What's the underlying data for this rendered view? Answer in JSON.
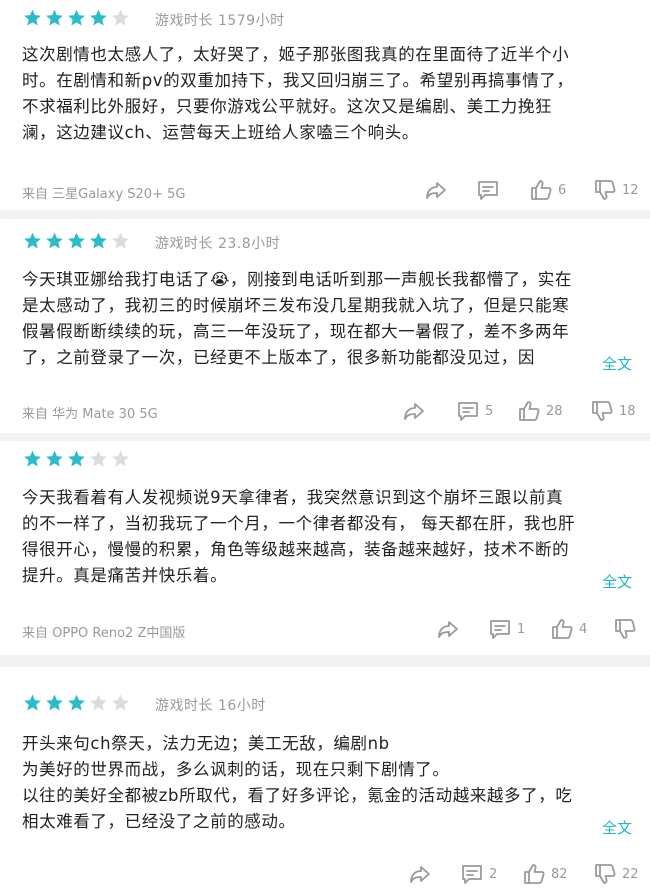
{
  "colors": {
    "star_on": "#2bbcc9",
    "star_off": "#dcdcdc",
    "link": "#24b6c4"
  },
  "reviews": [
    {
      "rating": 4,
      "playtime": "游戏时长 1579小时",
      "lines": [
        "这次剧情也太感人了，太好哭了，姬子那张图我真的在里面待了近半个小",
        "时。在剧情和新pv的双重加持下，我又回归崩三了。希望别再搞事情了，",
        "不求福利比外服好，只要你游戏公平就好。这次又是编剧、美工力挽狂",
        "澜，这边建议ch、运营每天上班给人家嗑三个响头。"
      ],
      "full_text_link": "",
      "device": "来自 三星Galaxy S20+ 5G",
      "replies": "",
      "likes": "6",
      "dislikes": "12"
    },
    {
      "rating": 4,
      "playtime": "游戏时长 23.8小时",
      "lines": [
        "今天琪亚娜给我打电话了😭，刚接到电话听到那一声舰长我都懵了，实在",
        "是太感动了，我初三的时候崩坏三发布没几星期我就入坑了，但是只能寒",
        "假暑假断断续续的玩，高三一年没玩了，现在都大一暑假了，差不多两年",
        "了，之前登录了一次，已经更不上版本了，很多新功能都没见过，因"
      ],
      "full_text_link": "全文",
      "device": "来自 华为 Mate 30 5G",
      "replies": "5",
      "likes": "28",
      "dislikes": "18"
    },
    {
      "rating": 3,
      "playtime": "",
      "lines": [
        "今天我看着有人发视频说9天拿律者，我突然意识到这个崩坏三跟以前真",
        "的不一样了，当初我玩了一个月，一个律者都没有， 每天都在肝，我也肝",
        "得很开心，慢慢的积累，角色等级越来越高，装备越来越好，技术不断的",
        "提升。真是痛苦并快乐着。"
      ],
      "full_text_link": "全文",
      "device": "来自 OPPO Reno2 Z中国版",
      "replies": "1",
      "likes": "4",
      "dislikes": ""
    },
    {
      "rating": 3,
      "playtime": "游戏时长 16小时",
      "lines": [
        "开头来句ch祭天，法力无边；美工无敌，编剧nb",
        "为美好的世界而战，多么讽刺的话，现在只剩下剧情了。",
        "以往的美好全都被zb所取代，看了好多评论，氪金的活动越来越多了，吃",
        "相太难看了，已经没了之前的感动。"
      ],
      "full_text_link": "全文",
      "device": "",
      "replies": "2",
      "likes": "82",
      "dislikes": "22"
    }
  ]
}
